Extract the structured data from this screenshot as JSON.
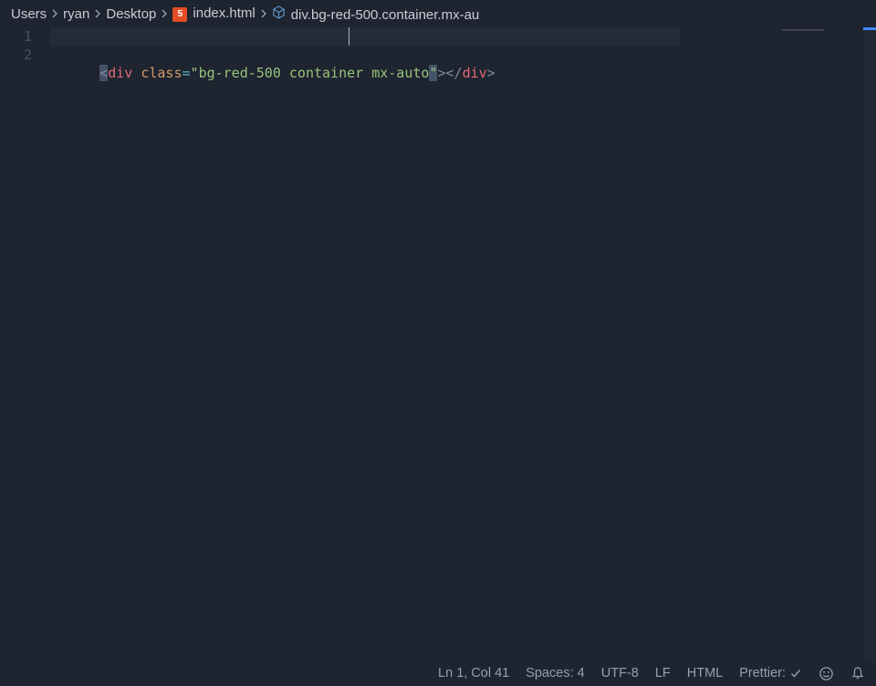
{
  "breadcrumb": {
    "segments": [
      "Users",
      "ryan",
      "Desktop"
    ],
    "file": "index.html",
    "symbol": "div.bg-red-500.container.mx-au"
  },
  "editor": {
    "line_numbers": [
      "1",
      "2"
    ],
    "code_line1": {
      "open_lt": "<",
      "tag_open": "div",
      "space1": " ",
      "attr": "class",
      "eq": "=",
      "q1": "\"",
      "val": "bg-red-500 container mx-auto",
      "q2": "\"",
      "close_gt": ">",
      "open_lt2": "<",
      "slash": "/",
      "tag_close": "div",
      "close_gt2": ">"
    }
  },
  "status": {
    "position": "Ln 1, Col 41",
    "indent": "Spaces: 4",
    "encoding": "UTF-8",
    "eol": "LF",
    "language": "HTML",
    "formatter": "Prettier:"
  }
}
